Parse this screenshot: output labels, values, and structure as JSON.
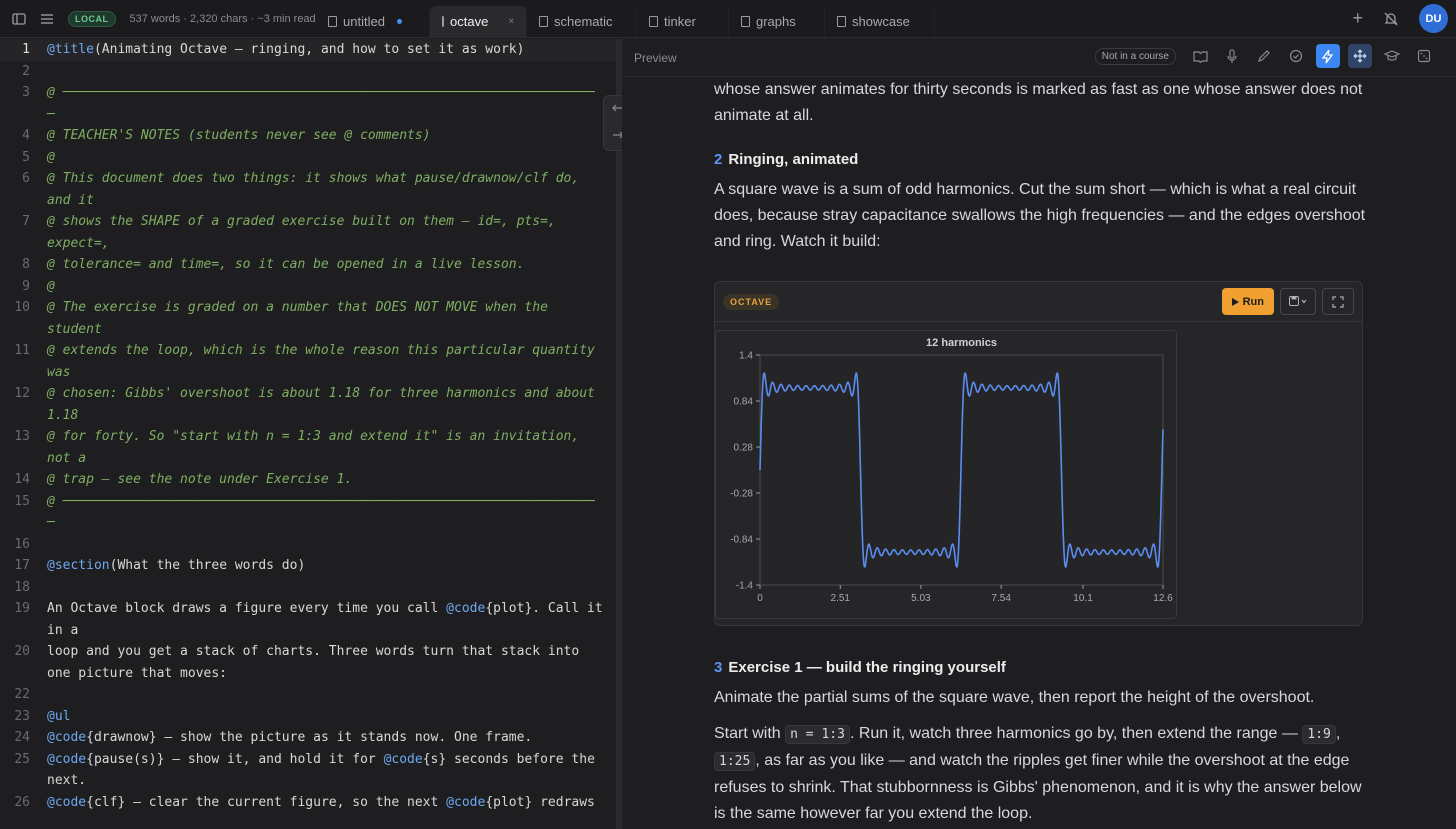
{
  "topbar": {
    "badge": "LOCAL",
    "stats": "537 words · 2,320 chars · ~3 min read",
    "tabs": [
      {
        "label": "untitled",
        "modified": true
      },
      {
        "label": "octave",
        "active": true
      },
      {
        "label": "schematic"
      },
      {
        "label": "tinker"
      },
      {
        "label": "graphs"
      },
      {
        "label": "showcase"
      }
    ],
    "close_glyph": "×",
    "new_tab_glyph": "+",
    "avatar": "DU"
  },
  "editor": {
    "lines": [
      {
        "n": "1",
        "html": "<span class=\"kw\">@title</span>(Animating Octave — ringing, and how to set it as work)"
      },
      {
        "n": "2",
        "html": ""
      },
      {
        "n": "3",
        "html": "<span class=\"cm\">@ ──────────────────────────────────────────────────────────────────── ─</span>"
      },
      {
        "n": "4",
        "html": "<span class=\"cm\">@ TEACHER'S NOTES (students never see @ comments)</span>"
      },
      {
        "n": "5",
        "html": "<span class=\"cm\">@</span>"
      },
      {
        "n": "6",
        "html": "<span class=\"cm\">@ This document does two things: it shows what pause/drawnow/clf do, and it</span>"
      },
      {
        "n": "7",
        "html": "<span class=\"cm\">@ shows the SHAPE of a graded exercise built on them — id=, pts=, expect=,</span>"
      },
      {
        "n": "8",
        "html": "<span class=\"cm\">@ tolerance= and time=, so it can be opened in a live lesson.</span>"
      },
      {
        "n": "9",
        "html": "<span class=\"cm\">@</span>"
      },
      {
        "n": "10",
        "html": "<span class=\"cm\">@ The exercise is graded on a number that DOES NOT MOVE when the student</span>"
      },
      {
        "n": "11",
        "html": "<span class=\"cm\">@ extends the loop, which is the whole reason this particular quantity was</span>"
      },
      {
        "n": "12",
        "html": "<span class=\"cm\">@ chosen: Gibbs' overshoot is about 1.18 for three harmonics and about 1.18</span>"
      },
      {
        "n": "13",
        "html": "<span class=\"cm\">@ for forty. So \"start with n = 1:3 and extend it\" is an invitation, not a</span>"
      },
      {
        "n": "14",
        "html": "<span class=\"cm\">@ trap — see the note under Exercise 1.</span>"
      },
      {
        "n": "15",
        "html": "<span class=\"cm\">@ ──────────────────────────────────────────────────────────────────── ─</span>"
      },
      {
        "n": "16",
        "html": ""
      },
      {
        "n": "17",
        "html": "<span class=\"kw\">@section</span>(What the three words do)"
      },
      {
        "n": "18",
        "html": ""
      },
      {
        "n": "19",
        "html": "An Octave block draws a figure every time you call <span class=\"kw\">@code</span>{plot}. Call it in a"
      },
      {
        "n": "20",
        "html": "loop and you get a stack of charts. Three words turn that stack into one picture that moves:"
      },
      {
        "n": "22",
        "html": ""
      },
      {
        "n": "23",
        "html": "<span class=\"kw\">@ul</span>"
      },
      {
        "n": "24",
        "html": "<span class=\"kw\">@code</span>{drawnow} — show the picture as it stands now. One frame."
      },
      {
        "n": "25",
        "html": "<span class=\"kw\">@code</span>{pause(s)} — show it, and hold it for <span class=\"kw\">@code</span>{s} seconds before the next."
      },
      {
        "n": "26",
        "html": "<span class=\"kw\">@code</span>{clf} — clear the current figure, so the next <span class=\"kw\">@code</span>{plot} redraws"
      }
    ]
  },
  "preview": {
    "title": "Preview",
    "course_pill": "Not in a course",
    "intro": "whose answer animates for thirty seconds is marked as fast as one whose answer does not animate at all.",
    "s2": {
      "num": "2",
      "title": "Ringing, animated",
      "body": "A square wave is a sum of odd harmonics. Cut the sum short — which is what a real circuit does, because stray capacitance swallows the high frequencies — and the edges overshoot and ring. Watch it build:"
    },
    "block": {
      "badge": "OCTAVE",
      "run": "Run"
    },
    "s3": {
      "num": "3",
      "title": "Exercise 1 — build the ringing yourself",
      "p1": "Animate the partial sums of the square wave, then report the height of the overshoot.",
      "p2a": "Start with ",
      "c1": "n = 1:3",
      "p2b": ". Run it, watch three harmonics go by, then extend the range — ",
      "c2": "1:9",
      "p2c": ", ",
      "c3": "1:25",
      "p2d": ", as far as you like — and watch the ripples get finer while the overshoot at the edge refuses to shrink. That stubbornness is Gibbs' phenomenon, and it is why the answer below is the same however far you extend the loop."
    }
  },
  "chart_data": {
    "type": "line",
    "title": "12 harmonics",
    "xlabel": "",
    "ylabel": "",
    "xlim": [
      0,
      12.6
    ],
    "ylim": [
      -1.4,
      1.4
    ],
    "xticks": [
      "0",
      "2.51",
      "5.03",
      "7.54",
      "10.1",
      "12.6"
    ],
    "yticks": [
      "1.4",
      "0.84",
      "0.28",
      "-0.28",
      "-0.84",
      "-1.4"
    ],
    "harmonics": 12,
    "period": 6.2832,
    "x_end": 12.6,
    "color": "#5b8df0",
    "grid": false
  }
}
